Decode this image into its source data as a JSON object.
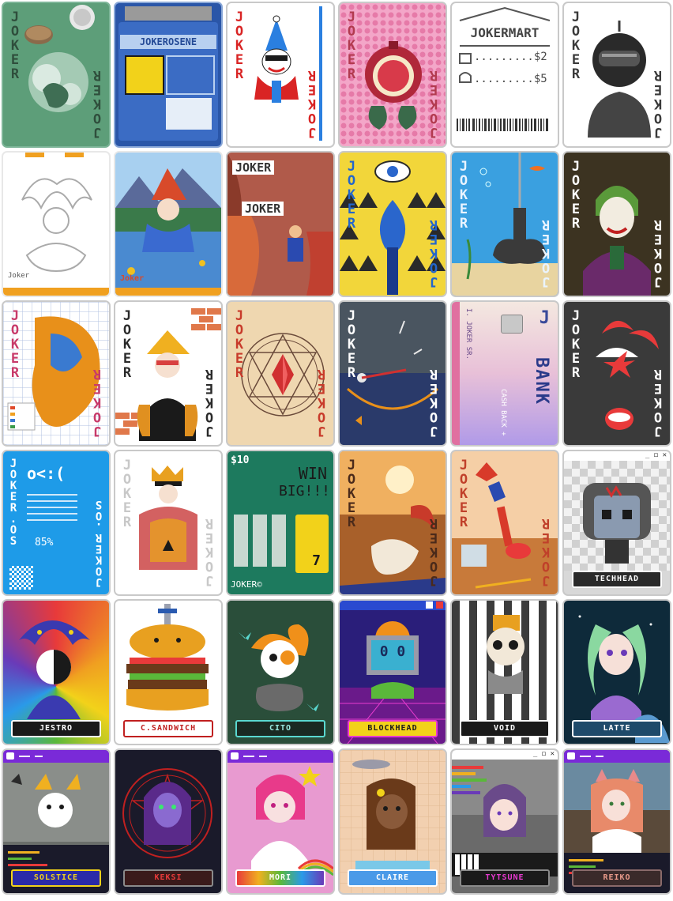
{
  "cards": [
    {
      "id": "joker-salt",
      "bg": "#5d9e79",
      "label_top": "JOKER",
      "label_bottom": "JOKER",
      "label_color": "#2f4e3c"
    },
    {
      "id": "jokerosene",
      "bg": "#2a56a8",
      "title": "JOKEROSENE",
      "title_bg": "#b8d0f0",
      "title_color": "#244a96"
    },
    {
      "id": "joker-classic",
      "bg": "#ffffff",
      "label_top": "JOKER",
      "label_bottom": "JOKER",
      "label_color": "#d92424",
      "accent": "#2a7fe0"
    },
    {
      "id": "joker-pomegranate",
      "bg": "#f3a6c8",
      "label_top": "JOKER",
      "label_bottom": "JOKER",
      "label_color": "#b23a4f"
    },
    {
      "id": "jokermart",
      "bg": "#ffffff",
      "title": "JOKERMART",
      "prices": [
        "$2",
        "$5"
      ],
      "dots": "........."
    },
    {
      "id": "joker-helmet",
      "bg": "#ffffff",
      "label_top": "JOKER",
      "label_bottom": "JOKER",
      "label_color": "#3a3a3a"
    },
    {
      "id": "joker-outline",
      "bg": "#ffffff",
      "caption": "Joker"
    },
    {
      "id": "joker-lake",
      "bg": "#7ab4e0",
      "caption": "Joker"
    },
    {
      "id": "joker-stage",
      "bg": "#b05a4a",
      "label_top": "JOKER",
      "label_bottom": "JOKER"
    },
    {
      "id": "joker-eye",
      "bg": "#f2d63a",
      "label_top": "JOKER",
      "label_bottom": "JOKER",
      "label_color": "#2266cc"
    },
    {
      "id": "joker-anchor",
      "bg": "#3aa0e0",
      "label_top": "JOKER",
      "label_bottom": "JOKER",
      "label_color": "#eaf4ff"
    },
    {
      "id": "joker-villain",
      "bg": "#2a2a22",
      "label_top": "JOKER",
      "label_bottom": "JOKER",
      "label_color": "#ffffff"
    },
    {
      "id": "joker-map",
      "bg": "#ffffff",
      "label_top": "JOKER",
      "label_bottom": "JOKER",
      "label_color": "#c83a6a"
    },
    {
      "id": "joker-bricks",
      "bg": "#ffffff",
      "label_top": "JOKER",
      "label_bottom": "JOKER",
      "label_color": "#2a2a2a"
    },
    {
      "id": "joker-crystal",
      "bg": "#efd7b0",
      "label_top": "JOKER",
      "label_bottom": "JOKER",
      "label_color": "#c83a2a"
    },
    {
      "id": "joker-gauge",
      "bg": "#4a5560",
      "label_top": "JOKER",
      "label_bottom": "JOKER",
      "label_color": "#ffffff"
    },
    {
      "id": "jbank",
      "bg": "#f2e2ea",
      "holder": "I. JOKER SR.",
      "bank": "BANK",
      "cashback": "CASH BACK +"
    },
    {
      "id": "joker-parachute",
      "bg": "#3a3a3a",
      "label_top": "JOKER",
      "label_bottom": "JOKER",
      "label_color": "#ffffff"
    },
    {
      "id": "joker-os",
      "bg": "#1e9be8",
      "label_top": "JOKER.OS",
      "label_bottom": "JOKER.OS",
      "face": "o<:(",
      "percent": "85%"
    },
    {
      "id": "joker-mosaic",
      "bg": "#ffffff",
      "label_top": "JOKER",
      "label_bottom": "JOKER",
      "label_color": "#c8c8c8"
    },
    {
      "id": "joker-scratch",
      "bg": "#1d7a5e",
      "price": "$10",
      "win": "WIN",
      "big": "BIG!!!",
      "footer": "JOKER©",
      "seven": "7"
    },
    {
      "id": "joker-desert",
      "bg": "#e0923a",
      "label_top": "JOKER",
      "label_bottom": "JOKER",
      "label_color": "#4a2a1a"
    },
    {
      "id": "joker-table",
      "bg": "#f5cfa6",
      "label_top": "JOKER",
      "label_bottom": "JOKER",
      "label_color": "#c0402a"
    },
    {
      "id": "techhead",
      "bg": "#d8d8d8",
      "name": "TECHHEAD",
      "window_buttons": "_ ◻ ✕"
    },
    {
      "id": "jestro",
      "bg": "#5a9a3a",
      "name": "JESTRO"
    },
    {
      "id": "c-sandwich",
      "bg": "#ffffff",
      "name": "C.SANDWICH"
    },
    {
      "id": "cito",
      "bg": "#1e3a2e",
      "name": "CITO"
    },
    {
      "id": "blockhead",
      "bg": "#2a1e7a",
      "name": "BLOCKHEAD",
      "face": "0 0"
    },
    {
      "id": "void",
      "bg": "#ffffff",
      "name": "VOID"
    },
    {
      "id": "latte",
      "bg": "#0e2a3a",
      "name": "LATTE"
    },
    {
      "id": "solstice",
      "bg": "#6a6e6a",
      "name": "SOLSTICE"
    },
    {
      "id": "keksi",
      "bg": "#1a1a2a",
      "name": "KEKSI"
    },
    {
      "id": "mori",
      "bg": "#e89ad0",
      "name": "MORI"
    },
    {
      "id": "claire",
      "bg": "#f2d0b0",
      "name": "CLAIRE"
    },
    {
      "id": "tytsune",
      "bg": "#6a6a6a",
      "name": "TYTSUNE"
    },
    {
      "id": "reiko",
      "bg": "#5a4a3a",
      "name": "REIKO"
    }
  ]
}
